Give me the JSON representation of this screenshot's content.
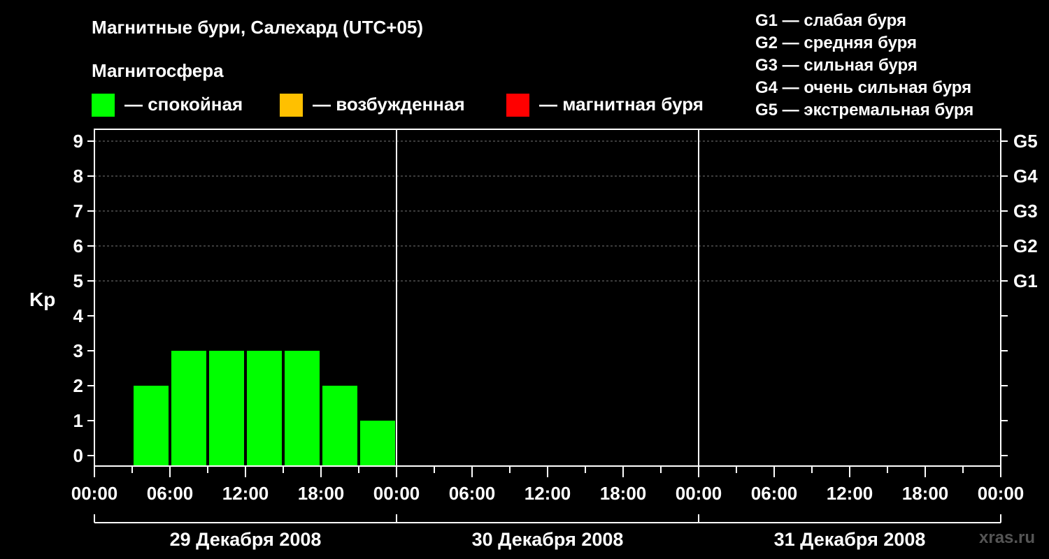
{
  "header": {
    "title": "Магнитные бури, Салехард (UTC+05)",
    "subtitle": "Магнитосфера"
  },
  "legend": [
    {
      "label": "— спокойная",
      "color": "#00ff00"
    },
    {
      "label": "— возбужденная",
      "color": "#ffc000"
    },
    {
      "label": "— магнитная буря",
      "color": "#ff0000"
    }
  ],
  "g_scale": [
    "G1 — слабая буря",
    "G2 — средняя буря",
    "G3 — сильная буря",
    "G4 — очень сильная буря",
    "G5 — экстремальная буря"
  ],
  "watermark": "xras.ru",
  "chart_data": {
    "type": "bar",
    "ylabel": "Kp",
    "ylim": [
      0,
      9
    ],
    "yticks": [
      "0",
      "1",
      "2",
      "3",
      "4",
      "5",
      "6",
      "7",
      "8",
      "9"
    ],
    "right_ticks": [
      {
        "kp": 5,
        "label": "G1"
      },
      {
        "kp": 6,
        "label": "G2"
      },
      {
        "kp": 7,
        "label": "G3"
      },
      {
        "kp": 8,
        "label": "G4"
      },
      {
        "kp": 9,
        "label": "G5"
      }
    ],
    "x_tick_labels": [
      "00:00",
      "06:00",
      "12:00",
      "18:00",
      "00:00",
      "06:00",
      "12:00",
      "18:00",
      "00:00",
      "06:00",
      "12:00",
      "18:00",
      "00:00"
    ],
    "days": [
      "29 Декабря 2008",
      "30 Декабря 2008",
      "31 Декабря 2008"
    ],
    "bars": [
      {
        "start_hour": 3,
        "value": 2
      },
      {
        "start_hour": 6,
        "value": 3
      },
      {
        "start_hour": 9,
        "value": 3
      },
      {
        "start_hour": 12,
        "value": 3
      },
      {
        "start_hour": 15,
        "value": 3
      },
      {
        "start_hour": 18,
        "value": 2
      },
      {
        "start_hour": 21,
        "value": 1
      }
    ],
    "bar_color": "#00ff00",
    "grid": true
  }
}
